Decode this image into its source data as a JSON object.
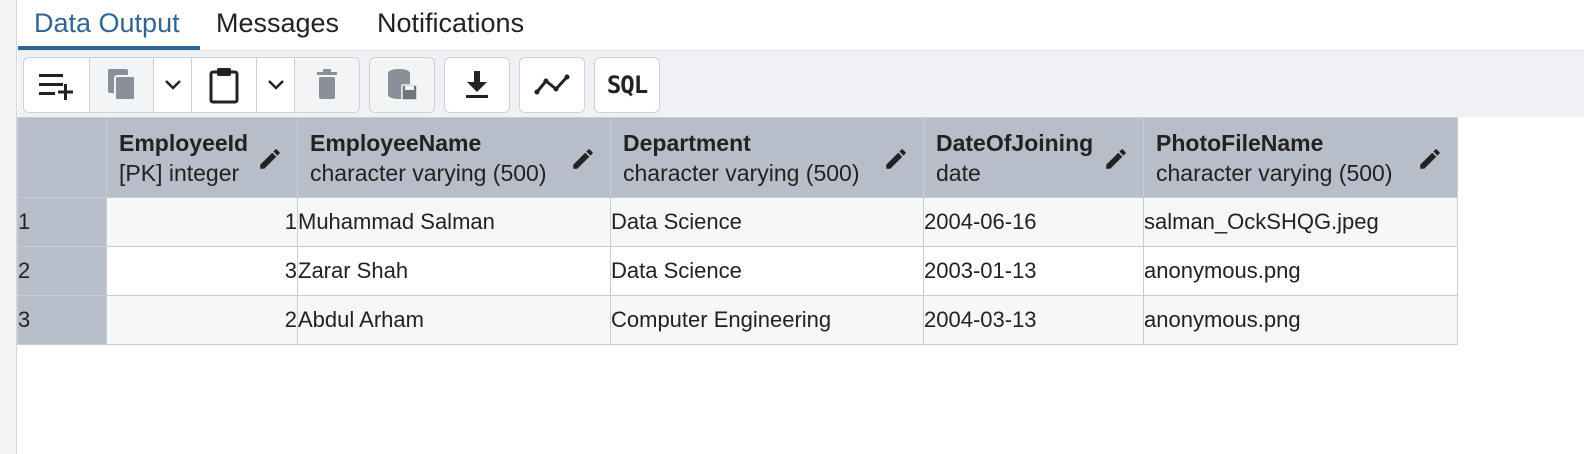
{
  "tabs": [
    {
      "label": "Data Output",
      "active": true
    },
    {
      "label": "Messages",
      "active": false
    },
    {
      "label": "Notifications",
      "active": false
    }
  ],
  "toolbar": {
    "buttons": [
      {
        "icon": "add-row-icon"
      },
      {
        "icon": "copy-icon"
      },
      {
        "icon": "chevron-down-icon"
      },
      {
        "icon": "paste-icon"
      },
      {
        "icon": "chevron-down-icon"
      },
      {
        "icon": "delete-icon"
      },
      {
        "icon": "save-data-icon"
      },
      {
        "icon": "download-icon"
      },
      {
        "icon": "graph-icon"
      },
      {
        "icon": "sql-icon",
        "label": "SQL"
      }
    ]
  },
  "grid": {
    "columns": [
      {
        "name": "EmployeeId",
        "type": "[PK] integer"
      },
      {
        "name": "EmployeeName",
        "type": "character varying (500)"
      },
      {
        "name": "Department",
        "type": "character varying (500)"
      },
      {
        "name": "DateOfJoining",
        "type": "date"
      },
      {
        "name": "PhotoFileName",
        "type": "character varying (500)"
      }
    ],
    "rows": [
      {
        "num": "1",
        "cells": [
          "1",
          "Muhammad Salman",
          "Data Science",
          "2004-06-16",
          "salman_OckSHQG.jpeg"
        ]
      },
      {
        "num": "2",
        "cells": [
          "3",
          "Zarar Shah",
          "Data Science",
          "2003-01-13",
          "anonymous.png"
        ]
      },
      {
        "num": "3",
        "cells": [
          "2",
          "Abdul Arham",
          "Computer Engineering",
          "2004-03-13",
          "anonymous.png"
        ]
      }
    ]
  },
  "colors": {
    "accent": "#326690",
    "header_bg": "#b7bdc9"
  }
}
